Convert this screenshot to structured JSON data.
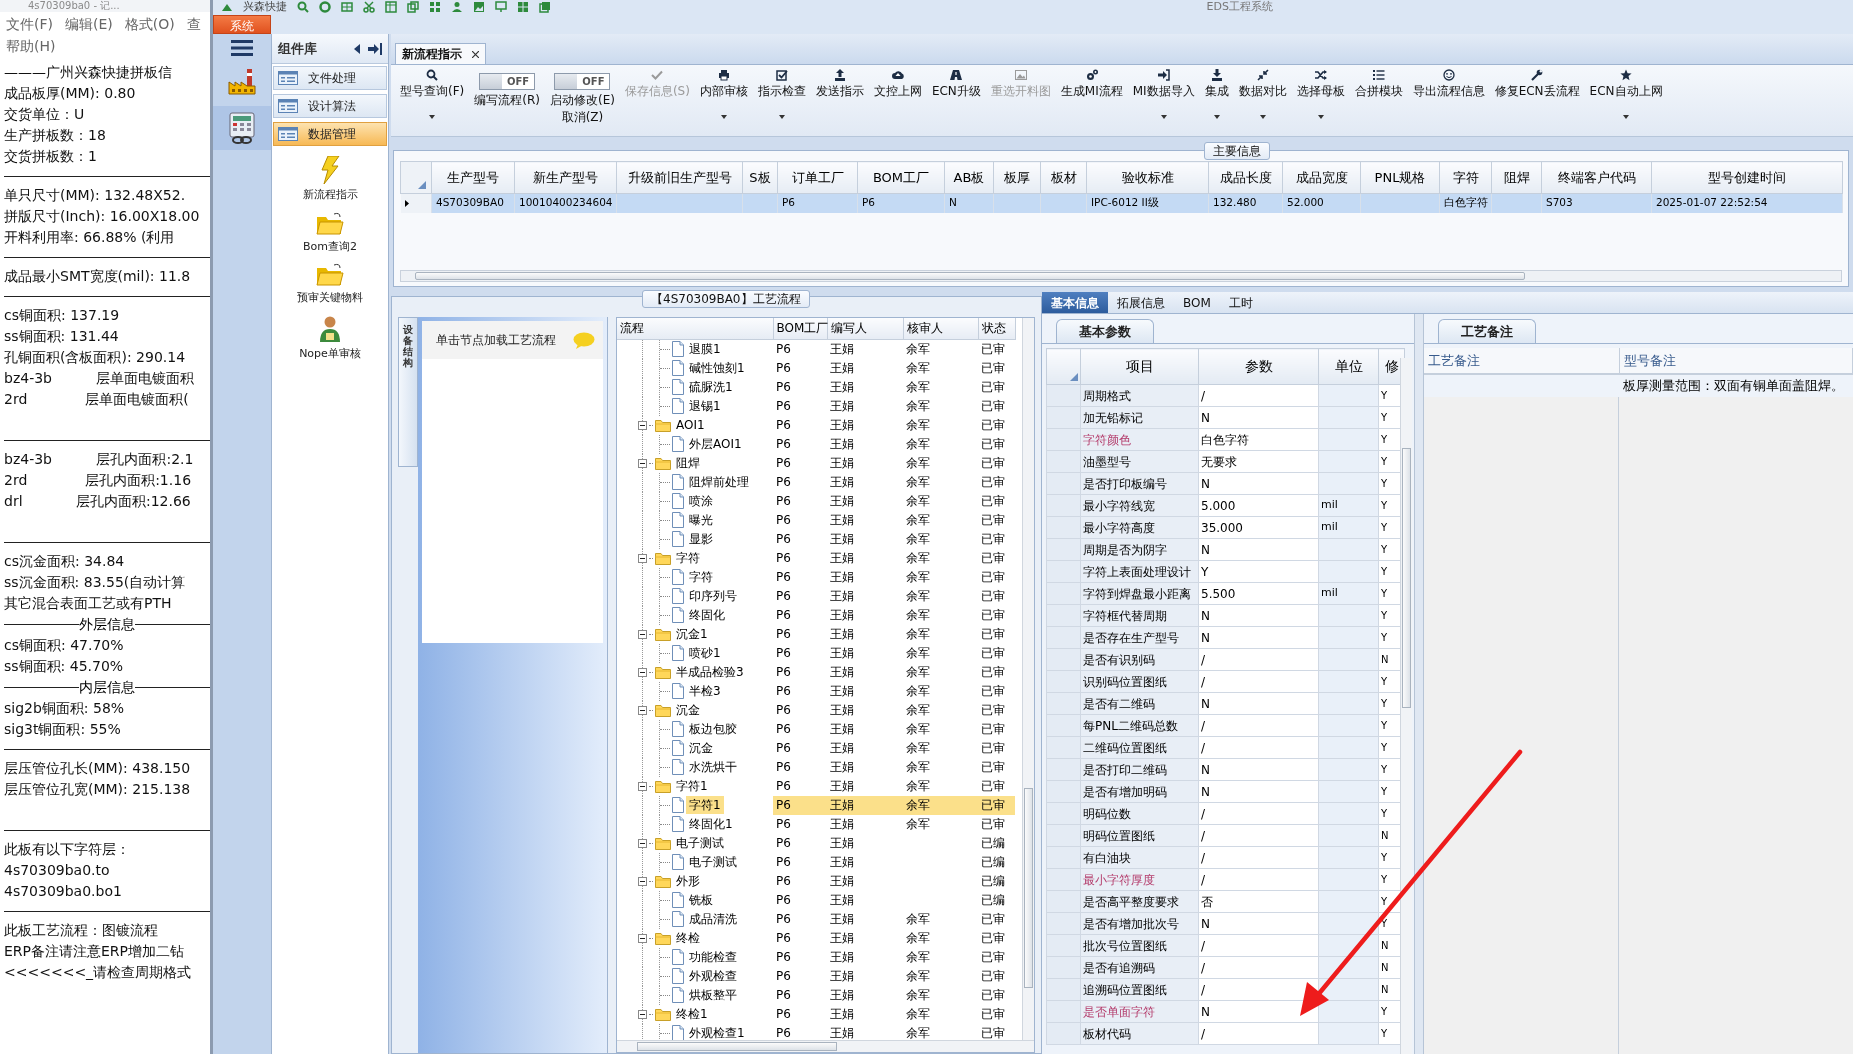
{
  "notepad": {
    "title": "4s70309ba0 - 记...",
    "menu": [
      "文件(F)",
      "编辑(E)",
      "格式(O)",
      "查",
      "帮助(H)"
    ],
    "lines": [
      {
        "kind": "text",
        "text": "———广州兴森快捷拼板信"
      },
      {
        "kind": "text",
        "text": "成品板厚(MM): 0.80"
      },
      {
        "kind": "text",
        "text": "交货单位：U"
      },
      {
        "kind": "text",
        "text": "生产拼板数：18"
      },
      {
        "kind": "text",
        "text": "交货拼板数：1"
      },
      {
        "kind": "rule"
      },
      {
        "kind": "text",
        "text": "单只尺寸(MM): 132.48X52."
      },
      {
        "kind": "text",
        "text": "拼版尺寸(Inch): 16.00X18.00"
      },
      {
        "kind": "text",
        "text": "开料利用率: 66.88% (利用"
      },
      {
        "kind": "rule"
      },
      {
        "kind": "text",
        "text": "成品最小SMT宽度(mil): 11.8"
      },
      {
        "kind": "rule"
      },
      {
        "kind": "text",
        "text": "cs铜面积: 137.19"
      },
      {
        "kind": "text",
        "text": "ss铜面积: 131.44"
      },
      {
        "kind": "text",
        "text": "孔铜面积(含板面积): 290.14"
      },
      {
        "kind": "text",
        "text": "bz4-3b          层单面电镀面积"
      },
      {
        "kind": "text",
        "text": "2rd             层单面电镀面积("
      },
      {
        "kind": "blank"
      },
      {
        "kind": "rule"
      },
      {
        "kind": "text",
        "text": "bz4-3b          层孔内面积:2.1"
      },
      {
        "kind": "text",
        "text": "2rd             层孔内面积:1.16"
      },
      {
        "kind": "text",
        "text": "drl            层孔内面积:12.66"
      },
      {
        "kind": "blank"
      },
      {
        "kind": "rule"
      },
      {
        "kind": "text",
        "text": "cs沉金面积: 34.84"
      },
      {
        "kind": "text",
        "text": "ss沉金面积: 83.55(自动计算"
      },
      {
        "kind": "text",
        "text": "其它混合表面工艺或有PTH"
      },
      {
        "kind": "heading",
        "text": "外层信息"
      },
      {
        "kind": "text",
        "text": "cs铜面积: 47.70%"
      },
      {
        "kind": "text",
        "text": "ss铜面积: 45.70%"
      },
      {
        "kind": "heading",
        "text": "内层信息"
      },
      {
        "kind": "text",
        "text": "sig2b铜面积: 58%"
      },
      {
        "kind": "text",
        "text": "sig3t铜面积: 55%"
      },
      {
        "kind": "rule"
      },
      {
        "kind": "text",
        "text": "层压管位孔长(MM): 438.150"
      },
      {
        "kind": "text",
        "text": "层压管位孔宽(MM): 215.138"
      },
      {
        "kind": "blank"
      },
      {
        "kind": "rule"
      },
      {
        "kind": "text",
        "text": "此板有以下字符层："
      },
      {
        "kind": "text",
        "text": "4s70309ba0.to"
      },
      {
        "kind": "text",
        "text": "4s70309ba0.bo1"
      },
      {
        "kind": "rule"
      },
      {
        "kind": "text",
        "text": "此板工艺流程：图镀流程"
      },
      {
        "kind": "text",
        "text": "ERP备注请注意ERP增加二钻"
      },
      {
        "kind": "text",
        "text": "<<<<<<<_请检查周期格式"
      }
    ]
  },
  "app": {
    "brand": "兴森快捷",
    "title": "EDS工程系统",
    "system_tab": "系统"
  },
  "nav": {
    "header": "组件库",
    "categories": [
      {
        "label": "文件处理",
        "selected": false
      },
      {
        "label": "设计算法",
        "selected": false
      },
      {
        "label": "数据管理",
        "selected": true
      }
    ],
    "tools": [
      {
        "label": "新流程指示",
        "kind": "lightning"
      },
      {
        "label": "Bom查询2",
        "kind": "folder"
      },
      {
        "label": "预审关键物料",
        "kind": "folder"
      },
      {
        "label": "Nope单审核",
        "kind": "person"
      }
    ]
  },
  "document_tabs": [
    {
      "label": "新流程指示",
      "selected": true
    }
  ],
  "toolbar": [
    {
      "kind": "button",
      "label": "型号查询(F)",
      "disabled": false,
      "menu": true
    },
    {
      "kind": "toggle",
      "switch_text": "OFF",
      "on": false,
      "label": "编写流程(R)"
    },
    {
      "kind": "toggle",
      "switch_text": "OFF",
      "on": false,
      "label": "启动修改(E)",
      "second_label": "取消(Z)"
    },
    {
      "kind": "button",
      "label": "保存信息(S)",
      "disabled": true,
      "menu": false
    },
    {
      "kind": "button",
      "label": "内部审核",
      "disabled": false,
      "menu": true
    },
    {
      "kind": "button",
      "label": "指示检查",
      "disabled": false,
      "menu": true
    },
    {
      "kind": "button",
      "label": "发送指示",
      "disabled": false,
      "menu": false
    },
    {
      "kind": "button",
      "label": "文控上网",
      "disabled": false,
      "menu": false
    },
    {
      "kind": "button",
      "label": "ECN升级",
      "disabled": false,
      "menu": false
    },
    {
      "kind": "button",
      "label": "重选开料图",
      "disabled": true,
      "menu": false
    },
    {
      "kind": "button",
      "label": "生成MI流程",
      "disabled": false,
      "menu": false
    },
    {
      "kind": "button",
      "label": "MI数据导入",
      "disabled": false,
      "menu": true
    },
    {
      "kind": "button",
      "label": "集成",
      "disabled": false,
      "menu": true
    },
    {
      "kind": "button",
      "label": "数据对比",
      "disabled": false,
      "menu": true
    },
    {
      "kind": "button",
      "label": "选择母板",
      "disabled": false,
      "menu": true
    },
    {
      "kind": "button",
      "label": "合拼模块",
      "disabled": false,
      "menu": false
    },
    {
      "kind": "button",
      "label": "导出流程信息",
      "disabled": false,
      "menu": false
    },
    {
      "kind": "button",
      "label": "修复ECN丢流程",
      "disabled": false,
      "menu": false
    },
    {
      "kind": "button",
      "label": "ECN自动上网",
      "disabled": false,
      "menu": true
    }
  ],
  "main_info": {
    "title": "主要信息",
    "columns": [
      "生产型号",
      "新生产型号",
      "升级前旧生产型号",
      "S板",
      "订单工厂",
      "BOM工厂",
      "AB板",
      "板厚",
      "板材",
      "验收标准",
      "成品长度",
      "成品宽度",
      "PNL规格",
      "字符",
      "阻焊",
      "终端客户代码",
      "型号创建时间"
    ],
    "rows": [
      {
        "selected": true,
        "cells": [
          "4S70309BA0",
          "10010400234604",
          null,
          null,
          "P6",
          "P6",
          "N",
          null,
          null,
          "IPC-6012 II级",
          "132.480",
          "52.000",
          null,
          "白色字符",
          null,
          "S703",
          "2025-01-07 22:52:54"
        ]
      }
    ]
  },
  "process": {
    "title": "【4S70309BA0】工艺流程",
    "side_tab": "设备结构",
    "hint": "单击节点加载工艺流程",
    "columns": [
      "流程",
      "BOM工厂",
      "编写人",
      "核审人",
      "状态"
    ],
    "continued": [
      {
        "name": "退膜1",
        "bom": "P6",
        "writer": "王娟",
        "reviewer": "余军",
        "status": "已审",
        "selected": false
      },
      {
        "name": "碱性蚀刻1",
        "bom": "P6",
        "writer": "王娟",
        "reviewer": "余军",
        "status": "已审",
        "selected": false
      },
      {
        "name": "硫脲洗1",
        "bom": "P6",
        "writer": "王娟",
        "reviewer": "余军",
        "status": "已审",
        "selected": false
      },
      {
        "name": "退锡1",
        "bom": "P6",
        "writer": "王娟",
        "reviewer": "余军",
        "status": "已审",
        "selected": false
      }
    ],
    "nodes": [
      {
        "name": "AOI1",
        "bom": "P6",
        "writer": "王娟",
        "reviewer": "余军",
        "status": "已审",
        "selected": false,
        "expanded": true,
        "children": [
          {
            "name": "外层AOI1",
            "bom": "P6",
            "writer": "王娟",
            "reviewer": "余军",
            "status": "已审",
            "selected": false
          }
        ]
      },
      {
        "name": "阻焊",
        "bom": "P6",
        "writer": "王娟",
        "reviewer": "余军",
        "status": "已审",
        "selected": false,
        "expanded": true,
        "children": [
          {
            "name": "阻焊前处理",
            "bom": "P6",
            "writer": "王娟",
            "reviewer": "余军",
            "status": "已审",
            "selected": false
          },
          {
            "name": "喷涂",
            "bom": "P6",
            "writer": "王娟",
            "reviewer": "余军",
            "status": "已审",
            "selected": false
          },
          {
            "name": "曝光",
            "bom": "P6",
            "writer": "王娟",
            "reviewer": "余军",
            "status": "已审",
            "selected": false
          },
          {
            "name": "显影",
            "bom": "P6",
            "writer": "王娟",
            "reviewer": "余军",
            "status": "已审",
            "selected": false
          }
        ]
      },
      {
        "name": "字符",
        "bom": "P6",
        "writer": "王娟",
        "reviewer": "余军",
        "status": "已审",
        "selected": false,
        "expanded": true,
        "children": [
          {
            "name": "字符",
            "bom": "P6",
            "writer": "王娟",
            "reviewer": "余军",
            "status": "已审",
            "selected": false
          },
          {
            "name": "印序列号",
            "bom": "P6",
            "writer": "王娟",
            "reviewer": "余军",
            "status": "已审",
            "selected": false
          },
          {
            "name": "终固化",
            "bom": "P6",
            "writer": "王娟",
            "reviewer": "余军",
            "status": "已审",
            "selected": false
          }
        ]
      },
      {
        "name": "沉金1",
        "bom": "P6",
        "writer": "王娟",
        "reviewer": "余军",
        "status": "已审",
        "selected": false,
        "expanded": true,
        "children": [
          {
            "name": "喷砂1",
            "bom": "P6",
            "writer": "王娟",
            "reviewer": "余军",
            "status": "已审",
            "selected": false
          }
        ]
      },
      {
        "name": "半成品检验3",
        "bom": "P6",
        "writer": "王娟",
        "reviewer": "余军",
        "status": "已审",
        "selected": false,
        "expanded": true,
        "children": [
          {
            "name": "半检3",
            "bom": "P6",
            "writer": "王娟",
            "reviewer": "余军",
            "status": "已审",
            "selected": false
          }
        ]
      },
      {
        "name": "沉金",
        "bom": "P6",
        "writer": "王娟",
        "reviewer": "余军",
        "status": "已审",
        "selected": false,
        "expanded": true,
        "children": [
          {
            "name": "板边包胶",
            "bom": "P6",
            "writer": "王娟",
            "reviewer": "余军",
            "status": "已审",
            "selected": false
          },
          {
            "name": "沉金",
            "bom": "P6",
            "writer": "王娟",
            "reviewer": "余军",
            "status": "已审",
            "selected": false
          },
          {
            "name": "水洗烘干",
            "bom": "P6",
            "writer": "王娟",
            "reviewer": "余军",
            "status": "已审",
            "selected": false
          }
        ]
      },
      {
        "name": "字符1",
        "bom": "P6",
        "writer": "王娟",
        "reviewer": "余军",
        "status": "已审",
        "selected": false,
        "expanded": true,
        "children": [
          {
            "name": "字符1",
            "bom": "P6",
            "writer": "王娟",
            "reviewer": "余军",
            "status": "已审",
            "selected": true
          },
          {
            "name": "终固化1",
            "bom": "P6",
            "writer": "王娟",
            "reviewer": "余军",
            "status": "已审",
            "selected": false
          }
        ]
      },
      {
        "name": "电子测试",
        "bom": "P6",
        "writer": "王娟",
        "status": "已编",
        "selected": false,
        "expanded": true,
        "children": [
          {
            "name": "电子测试",
            "bom": "P6",
            "writer": "王娟",
            "status": "已编",
            "selected": false
          }
        ]
      },
      {
        "name": "外形",
        "bom": "P6",
        "writer": "王娟",
        "status": "已编",
        "selected": false,
        "expanded": true,
        "children": [
          {
            "name": "铣板",
            "bom": "P6",
            "writer": "王娟",
            "status": "已编",
            "selected": false
          },
          {
            "name": "成品清洗",
            "bom": "P6",
            "writer": "王娟",
            "reviewer": "余军",
            "status": "已审",
            "selected": false
          }
        ]
      },
      {
        "name": "终检",
        "bom": "P6",
        "writer": "王娟",
        "reviewer": "余军",
        "status": "已审",
        "selected": false,
        "expanded": true,
        "children": [
          {
            "name": "功能检查",
            "bom": "P6",
            "writer": "王娟",
            "reviewer": "余军",
            "status": "已审",
            "selected": false
          },
          {
            "name": "外观检查",
            "bom": "P6",
            "writer": "王娟",
            "reviewer": "余军",
            "status": "已审",
            "selected": false
          },
          {
            "name": "烘板整平",
            "bom": "P6",
            "writer": "王娟",
            "reviewer": "余军",
            "status": "已审",
            "selected": false
          }
        ]
      },
      {
        "name": "终检1",
        "bom": "P6",
        "writer": "王娟",
        "reviewer": "余军",
        "status": "已审",
        "selected": false,
        "expanded": true,
        "children": [
          {
            "name": "外观检查1",
            "bom": "P6",
            "writer": "王娟",
            "reviewer": "余军",
            "status": "已审",
            "selected": false
          }
        ]
      }
    ]
  },
  "details": {
    "tabs": [
      {
        "label": "基本信息",
        "selected": true
      },
      {
        "label": "拓展信息",
        "selected": false
      },
      {
        "label": "BOM",
        "selected": false
      },
      {
        "label": "工时",
        "selected": false
      }
    ],
    "params": {
      "title": "基本参数",
      "columns": [
        "项目",
        "参数",
        "单位",
        "修"
      ],
      "rows": [
        {
          "item": "周期格式",
          "value": "/",
          "flag": "Y",
          "highlighted": false
        },
        {
          "item": "加无铅标记",
          "value": "N",
          "flag": "Y",
          "highlighted": false
        },
        {
          "item": "字符颜色",
          "value": "白色字符",
          "flag": "Y",
          "highlighted": true
        },
        {
          "item": "油墨型号",
          "value": "无要求",
          "flag": "Y",
          "highlighted": false
        },
        {
          "item": "是否打印板编号",
          "value": "N",
          "flag": "Y",
          "highlighted": false
        },
        {
          "item": "最小字符线宽",
          "value": "5.000",
          "unit": "mil",
          "flag": "Y",
          "highlighted": false
        },
        {
          "item": "最小字符高度",
          "value": "35.000",
          "unit": "mil",
          "flag": "Y",
          "highlighted": false
        },
        {
          "item": "周期是否为阴字",
          "value": "N",
          "flag": "Y",
          "highlighted": false
        },
        {
          "item": "字符上表面处理设计",
          "value": "Y",
          "flag": "Y",
          "highlighted": false
        },
        {
          "item": "字符到焊盘最小距离",
          "value": "5.500",
          "unit": "mil",
          "flag": "Y",
          "highlighted": false
        },
        {
          "item": "字符框代替周期",
          "value": "N",
          "flag": "Y",
          "highlighted": false
        },
        {
          "item": "是否存在生产型号",
          "value": "N",
          "flag": "Y",
          "highlighted": false
        },
        {
          "item": "是否有识别码",
          "value": "/",
          "flag": "N",
          "highlighted": false
        },
        {
          "item": "识别码位置图纸",
          "value": "/",
          "flag": "Y",
          "highlighted": false
        },
        {
          "item": "是否有二维码",
          "value": "N",
          "flag": "Y",
          "highlighted": false
        },
        {
          "item": "每PNL二维码总数",
          "value": "/",
          "flag": "Y",
          "highlighted": false
        },
        {
          "item": "二维码位置图纸",
          "value": "/",
          "flag": "Y",
          "highlighted": false
        },
        {
          "item": "是否打印二维码",
          "value": "N",
          "flag": "Y",
          "highlighted": false
        },
        {
          "item": "是否有增加明码",
          "value": "N",
          "flag": "Y",
          "highlighted": false
        },
        {
          "item": "明码位数",
          "value": "/",
          "flag": "Y",
          "highlighted": false
        },
        {
          "item": "明码位置图纸",
          "value": "/",
          "flag": "N",
          "highlighted": false
        },
        {
          "item": "有白油块",
          "value": "/",
          "flag": "Y",
          "highlighted": false
        },
        {
          "item": "最小字符厚度",
          "value": "/",
          "flag": "Y",
          "highlighted": true
        },
        {
          "item": "是否高平整度要求",
          "value": "否",
          "flag": "Y",
          "highlighted": false
        },
        {
          "item": "是否有增加批次号",
          "value": "N",
          "flag": "Y",
          "highlighted": false
        },
        {
          "item": "批次号位置图纸",
          "value": "/",
          "flag": "N",
          "highlighted": false
        },
        {
          "item": "是否有追溯码",
          "value": "/",
          "flag": "N",
          "highlighted": false
        },
        {
          "item": "追溯码位置图纸",
          "value": "/",
          "flag": "N",
          "highlighted": false
        },
        {
          "item": "是否单面字符",
          "value": "N",
          "flag": "Y",
          "highlighted": true
        },
        {
          "item": "板材代码",
          "value": "/",
          "flag": "Y",
          "highlighted": false
        }
      ]
    },
    "notes": {
      "title": "工艺备注",
      "columns": [
        "工艺备注",
        "型号备注"
      ],
      "model_note": "板厚测量范围：双面有铜单面盖阻焊。"
    }
  },
  "annotations": [
    {
      "kind": "arrow"
    }
  ]
}
